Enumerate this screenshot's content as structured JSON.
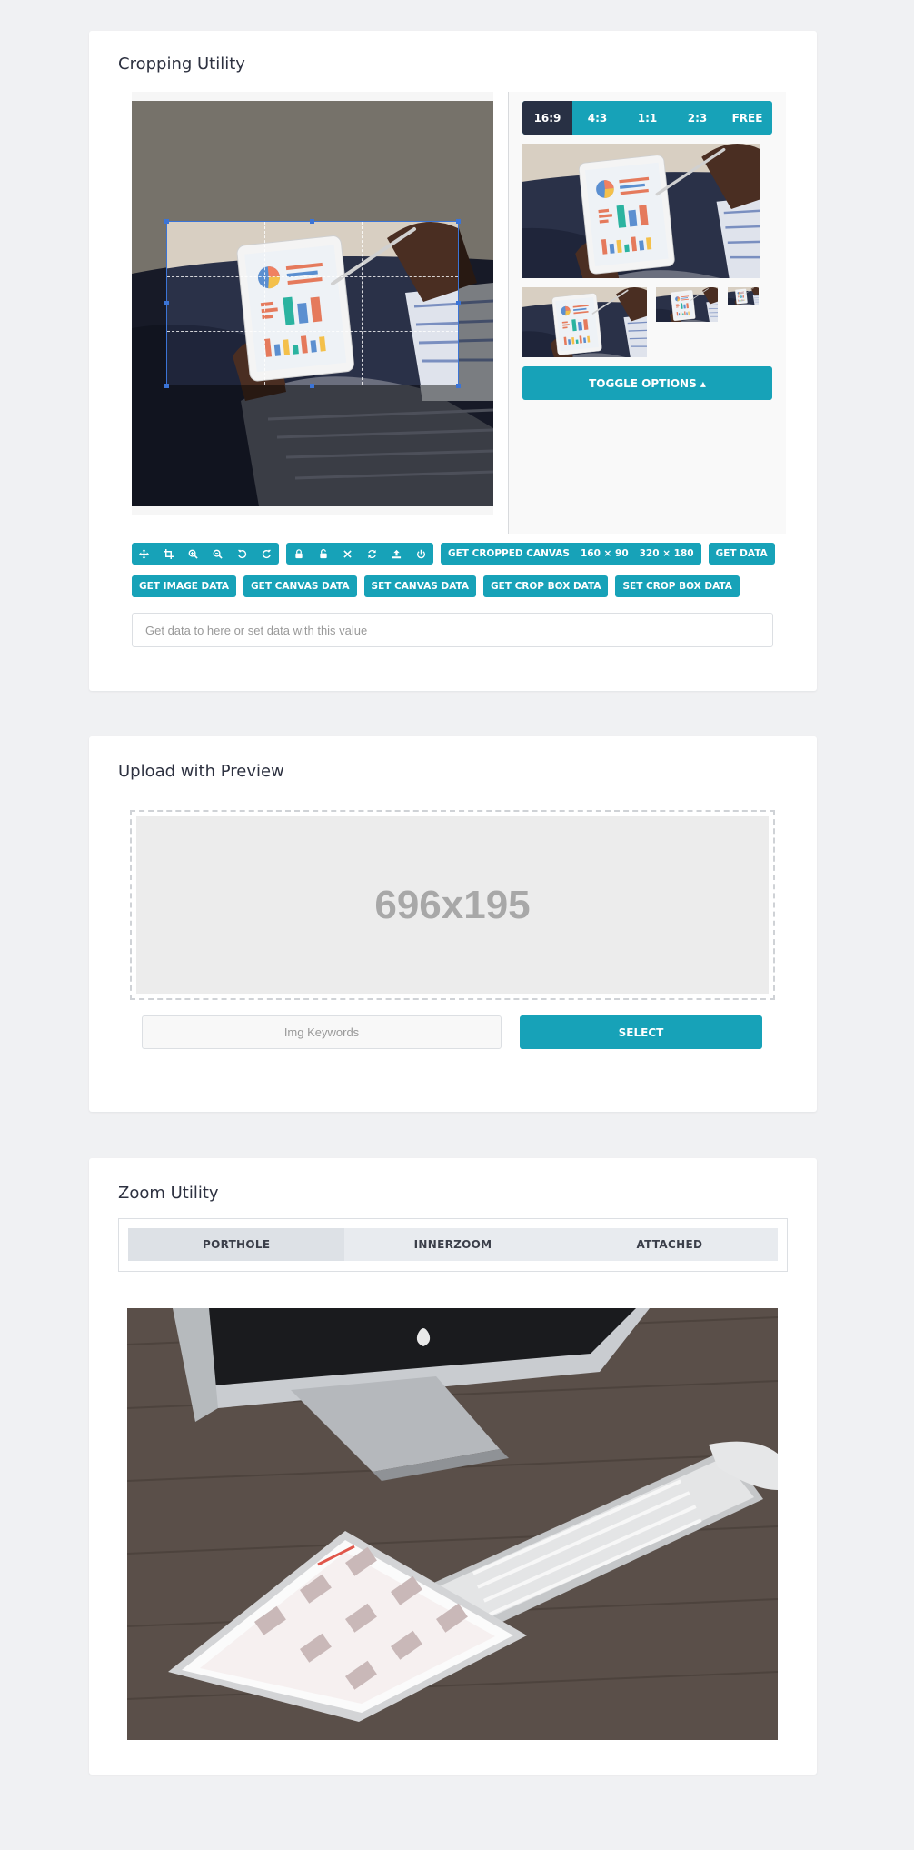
{
  "crop": {
    "title": "Cropping Utility",
    "ratios": [
      "16:9",
      "4:3",
      "1:1",
      "2:3",
      "FREE"
    ],
    "toggle_label": "TOGGLE OPTIONS ▴",
    "tool_icons": [
      "move-icon",
      "crop-icon",
      "zoom-in-icon",
      "zoom-out-icon",
      "rotate-left-icon",
      "rotate-right-icon"
    ],
    "tool_icons2": [
      "lock-icon",
      "unlock-icon",
      "clear-icon",
      "reset-icon",
      "upload-icon",
      "power-icon"
    ],
    "btn_get_cropped": "GET CROPPED CANVAS",
    "btn_160": "160 × 90",
    "btn_320": "320 × 180",
    "btn_get_data": "GET DATA",
    "btn_get_image": "GET IMAGE DATA",
    "btn_get_canvas": "GET CANVAS DATA",
    "btn_set_canvas": "SET CANVAS DATA",
    "btn_get_cropbox": "GET CROP BOX DATA",
    "btn_set_cropbox": "SET CROP BOX DATA",
    "data_placeholder": "Get data to here or set data with this value"
  },
  "upload": {
    "title": "Upload with Preview",
    "placeholder_size": "696x195",
    "keywords_placeholder": "Img Keywords",
    "select_label": "SELECT"
  },
  "zoom": {
    "title": "Zoom Utility",
    "tabs": [
      "PORTHOLE",
      "INNERZOOM",
      "ATTACHED"
    ]
  },
  "colors": {
    "accent": "#17a2b8",
    "dark": "#283044",
    "bg": "#f0f1f3"
  }
}
